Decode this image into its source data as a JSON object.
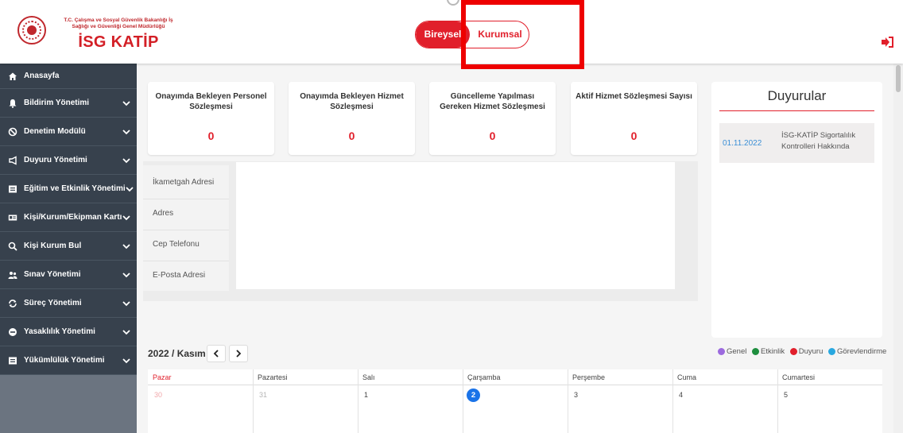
{
  "header": {
    "ministry_line1": "T.C. Çalışma ve Sosyal Güvenlik Bakanlığı İş",
    "ministry_line2": "Sağlığı ve Güvenliği Genel Müdürlüğü",
    "brand": "İSG KATİP",
    "toggle": {
      "active": "Bireysel",
      "inactive": "Kurumsal"
    },
    "logout_icon": "sign-out-icon",
    "accent_color": "#e11f2b"
  },
  "sidebar": {
    "items": [
      {
        "label": "Anasayfa",
        "icon": "home-icon",
        "has_chevron": false
      },
      {
        "label": "Bildirim Yönetimi",
        "icon": "bell-icon",
        "has_chevron": true
      },
      {
        "label": "Denetim Modülü",
        "icon": "ban-icon",
        "has_chevron": true
      },
      {
        "label": "Duyuru Yönetimi",
        "icon": "megaphone-icon",
        "has_chevron": true
      },
      {
        "label": "Eğitim ve Etkinlik Yönetimi",
        "icon": "list-box-icon",
        "has_chevron": true
      },
      {
        "label": "Kişi/Kurum/Ekipman Kartı",
        "icon": "id-card-icon",
        "has_chevron": true
      },
      {
        "label": "Kişi Kurum Bul",
        "icon": "search-icon",
        "has_chevron": true
      },
      {
        "label": "Sınav Yönetimi",
        "icon": "users-icon",
        "has_chevron": true
      },
      {
        "label": "Süreç Yönetimi",
        "icon": "sync-icon",
        "has_chevron": true
      },
      {
        "label": "Yasaklılık Yönetimi",
        "icon": "minus-circle-icon",
        "has_chevron": true
      },
      {
        "label": "Yükümlülük Yönetimi",
        "icon": "list-box-icon",
        "has_chevron": true
      }
    ]
  },
  "stats": [
    {
      "title": "Onayımda Bekleyen Personel Sözleşmesi",
      "value": "0"
    },
    {
      "title": "Onayımda Bekleyen Hizmet Sözleşmesi",
      "value": "0"
    },
    {
      "title": "Güncelleme Yapılması Gereken Hizmet Sözleşmesi",
      "value": "0"
    },
    {
      "title": "Aktif Hizmet Sözleşmesi Sayısı",
      "value": "0"
    }
  ],
  "info": {
    "labels": [
      "İkametgah Adresi",
      "Adres",
      "Cep Telefonu",
      "E-Posta Adresi"
    ]
  },
  "announcements": {
    "title": "Duyurular",
    "items": [
      {
        "date": "01.11.2022",
        "text": "İSG-KATİP Sigortalılık Kontrolleri Hakkında"
      }
    ]
  },
  "legend": [
    {
      "label": "Genel",
      "color": "#9c6ade"
    },
    {
      "label": "Etkinlik",
      "color": "#1e8e3e"
    },
    {
      "label": "Duyuru",
      "color": "#e11f2b"
    },
    {
      "label": "Görevlendirme",
      "color": "#29a8e0"
    }
  ],
  "calendar": {
    "month_label": "2022 / Kasım",
    "weekdays": [
      "Pazar",
      "Pazartesi",
      "Salı",
      "Çarşamba",
      "Perşembe",
      "Cuma",
      "Cumartesi"
    ],
    "days": [
      "30",
      "31",
      "1",
      "2",
      "3",
      "4",
      "5"
    ],
    "today": "2",
    "today_color": "#1a73e8"
  }
}
